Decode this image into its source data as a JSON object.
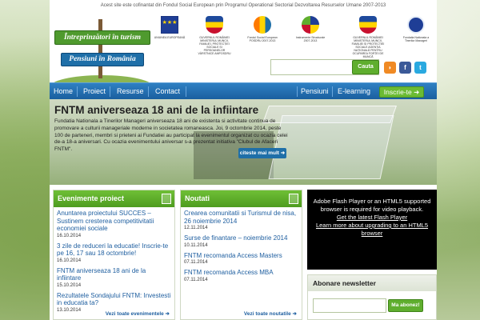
{
  "header": {
    "topline": "Acest site este cofinantat din Fondul Social European prin Programul Operational Sectorial Dezvoltarea Resurselor Umane 2007-2013",
    "sign_top": "Întreprinzători în turism",
    "sign_bottom": "Pensiuni în România",
    "partner_logos": [
      {
        "label": "UNIUNEA EUROPEANĂ",
        "icon": "eu-flag-icon"
      },
      {
        "label": "GUVERNUL ROMÂNIEI MINISTERUL MUNCII, FAMILIEI, PROTECȚIEI SOCIALE ȘI PERSOANELOR VÂRSTNICE AMPOSDRU",
        "icon": "romania-crest-icon"
      },
      {
        "label": "Fondul Social European POSDRU 2007-2013",
        "icon": "fse-icon"
      },
      {
        "label": "Instrumente Structurale 2007-2013",
        "icon": "structural-instruments-icon"
      },
      {
        "label": "GUVERNUL ROMÂNIEI MINISTERUL MUNCII, FAMILIEI ȘI PROTECȚIEI SOCIALE AGENȚIA NAȚIONALĂ PENTRU OCUPAREA FORȚEI DE MUNCĂ",
        "icon": "romania-crest-icon"
      },
      {
        "label": "Fundatia Nationala a Tinerilor Manageri",
        "icon": "fntm-logo-icon"
      }
    ],
    "search_placeholder": "",
    "search_button": "Cauta",
    "social": [
      {
        "name": "rss",
        "glyph": "◗",
        "color": "#f08a24"
      },
      {
        "name": "facebook",
        "glyph": "f",
        "color": "#3b5998"
      },
      {
        "name": "twitter",
        "glyph": "t",
        "color": "#2aa9e0"
      }
    ]
  },
  "nav": {
    "left": [
      "Home",
      "Proiect",
      "Resurse",
      "Contact"
    ],
    "right": [
      "Pensiuni",
      "E-learning"
    ],
    "cta": "Inscrie-te ➜"
  },
  "hero": {
    "title": "FNTM aniverseaza 18 ani de la infiintare",
    "text": "Fundatia Nationala a Tinerilor Manageri aniverseaza 18 ani de existenta si activitate continua de promovare a culturii manageriale moderne in societatea romaneasca. Joi, 9 octombrie 2014, peste 100 de parteneri, membri si prieteni ai Fundatiei au participat la evenimentul organizat cu ocazia celei de-a 18-a aniversari. Cu ocazia evenimentului aniversar s-a prezentat initiativa \"Clubul de Afaceri FNTM\".",
    "more": "citeste mai mult ➜"
  },
  "events": {
    "title": "Evenimente proiect",
    "items": [
      {
        "title": "Anuntarea proiectului SUCCES – Sustinem cresterea competitivitatii economiei sociale",
        "date": "16.10.2014"
      },
      {
        "title": "3 zile de reduceri la educatie! Inscrie-te pe 16, 17 sau 18 octombrie!",
        "date": "16.10.2014"
      },
      {
        "title": "FNTM aniverseaza 18 ani de la infiintare",
        "date": "15.10.2014"
      },
      {
        "title": "Rezultatele Sondajului FNTM: Investesti in educatia ta?",
        "date": "13.10.2014"
      }
    ],
    "all_link": "Vezi toate evenimentele ➜"
  },
  "news": {
    "title": "Noutati",
    "items": [
      {
        "title": "Crearea comunitatii si Turismul de nisa, 26 noiembrie 2014",
        "date": "12.11.2014"
      },
      {
        "title": "Surse de finantare – noiembrie 2014",
        "date": "10.11.2014"
      },
      {
        "title": "FNTM recomanda Access Masters",
        "date": "07.11.2014"
      },
      {
        "title": "FNTM recomanda Access MBA",
        "date": "07.11.2014"
      }
    ],
    "all_link": "Vezi toate noutatile ➜"
  },
  "video": {
    "line1": "Adobe Flash Player or an HTML5 supported browser is required for video playback.",
    "link1": "Get the latest Flash Player",
    "link2": "Learn more about upgrading to an HTML5 browser"
  },
  "newsletter": {
    "title": "Abonare newsletter",
    "placeholder": "",
    "button": "Ma abonez!"
  },
  "colors": {
    "accent_green": "#5fae2e",
    "nav_blue": "#1f6fa8",
    "link_blue": "#1f5fa0"
  }
}
